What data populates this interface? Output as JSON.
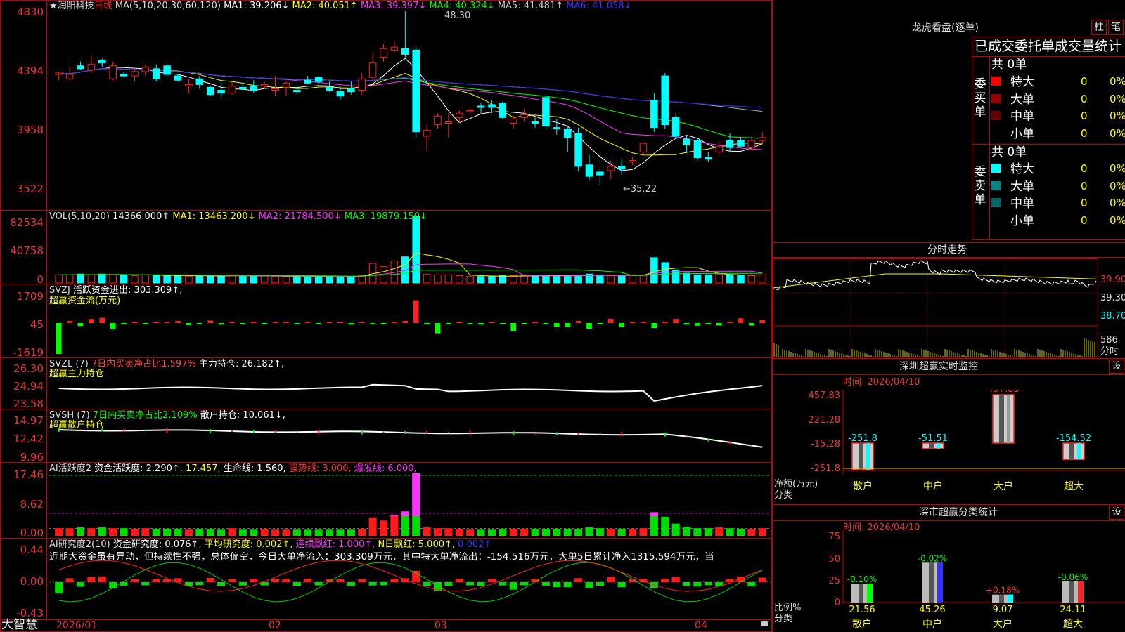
{
  "colors": {
    "up": "#ff2020",
    "down": "#00ffff",
    "ma1": "#ffffff",
    "ma2": "#ffff00",
    "ma3": "#ff33ff",
    "ma4": "#00ff00",
    "ma5": "#aaaaaa",
    "ma6": "#3333ff",
    "border": "#c00000"
  },
  "app": {
    "title": "★润阳科技",
    "period": "日线",
    "brand": "大智慧"
  },
  "price_legend": {
    "ma": "MA(5,10,20,30,60,120)",
    "ma1": "MA1: 39.206↓",
    "ma2": "MA2: 40.051↑",
    "ma3": "MA3: 39.397↓",
    "ma4": "MA4: 40.324↓",
    "ma5": "MA5: 41.481↑",
    "ma6": "MA6: 41.058↓",
    "high_mark": "48.30",
    "low_mark": "←35.22"
  },
  "vol_legend": {
    "name": "VOL(5,10,20)",
    "v": "14366.000↑",
    "ma1": "MA1: 13463.200↓",
    "ma2": "MA2: 21784.500↓",
    "ma3": "MA3: 19879.150↓"
  },
  "svzj": {
    "name": "SVZJ",
    "text": "活跃资金进出: 303.309↑,",
    "sub": "超赢资金流(万元)"
  },
  "svzl": {
    "name": "SVZL (7)",
    "pct": "7日内买卖净占比1.597%",
    "text": "主力持仓: 26.182↑,",
    "sub": "超赢主力持仓"
  },
  "svsh": {
    "name": "SVSH (7)",
    "pct": "7日内买卖净占比2.109%",
    "text": "散户持仓: 10.061↓,",
    "sub": "超赢散户持仓"
  },
  "ai1": {
    "name": "AI活跃度2",
    "a": "资金活跃度: 2.290↑,",
    "b": "17.457,",
    "c": "生命线: 1.560,",
    "d": "强势线: 3.000,",
    "e": "爆发线: 6.000,"
  },
  "ai2": {
    "name": "AI研究度2(10)",
    "a": "资金研究度: 0.076↑,",
    "b": "平均研究度: 0.002↑,",
    "c": "连续飘红: 1.000↑,",
    "d": "N日飘红: 5.000↑,",
    "e": "0.002↑",
    "comment": "近期大资金虽有异动，但持续性不强，总体偏空，今日大单净流入：303.309万元，其中特大单净流出：-154.516万元，大单5日累计净入1315.594万元，当"
  },
  "axes": {
    "price": [
      "4830",
      "4394",
      "3958",
      "3522"
    ],
    "vol": [
      "82534",
      "40758",
      "0"
    ],
    "svzj": [
      "1709",
      "45",
      "-1619"
    ],
    "svzl": [
      "26.30",
      "24.94",
      "23.58"
    ],
    "svsh": [
      "14.97",
      "12.42",
      "9.96"
    ],
    "ai1": [
      "17.46",
      "8.62",
      "0.00"
    ],
    "ai2": [
      "0.44",
      "0.00",
      "-0.43"
    ]
  },
  "dates": [
    "2026/01",
    "02",
    "03",
    "04"
  ],
  "lhb": {
    "title": "龙虎看盘(逐单)",
    "btn1": "柱",
    "btn2": "笔",
    "subtitle": "已成交委托单成交量统计",
    "buy_label": "委买单",
    "sell_label": "委卖单",
    "total_buy": "共 0单",
    "total_sell": "共 0单",
    "buy": [
      {
        "name": "特大",
        "qty": "0",
        "pct": "0%",
        "color": "#ff0000"
      },
      {
        "name": "大单",
        "qty": "0",
        "pct": "0%",
        "color": "#990000"
      },
      {
        "name": "中单",
        "qty": "0",
        "pct": "0%",
        "color": "#660000"
      },
      {
        "name": "小单",
        "qty": "0",
        "pct": "0%",
        "color": "#000000"
      }
    ],
    "sell": [
      {
        "name": "特大",
        "qty": "0",
        "pct": "0%",
        "color": "#00ffff"
      },
      {
        "name": "大单",
        "qty": "0",
        "pct": "0%",
        "color": "#008888"
      },
      {
        "name": "中单",
        "qty": "0",
        "pct": "0%",
        "color": "#006666"
      },
      {
        "name": "小单",
        "qty": "0",
        "pct": "0%",
        "color": "#000000"
      }
    ]
  },
  "fenshi": {
    "title": "分时走势",
    "p1": "39.90",
    "p2": "39.30",
    "p3": "38.70",
    "v": "586",
    "unit": "分时"
  },
  "monitor": {
    "title": "深圳超赢实时监控",
    "btn": "设",
    "time": "时间: 2026/04/10",
    "axis": [
      "457.83",
      "221.28",
      "-15.28",
      "-251.8"
    ],
    "ylabel1": "净额(万元)",
    "ylabel2": "分类",
    "cats": [
      "散户",
      "中户",
      "大户",
      "超大"
    ],
    "vals": [
      "-251.8",
      "-51.51",
      "457.83",
      "-154.52"
    ]
  },
  "classify": {
    "title": "深市超赢分类统计",
    "btn": "设",
    "time": "时间: 2026/04/10",
    "axis": [
      "75",
      "50",
      "25",
      "0"
    ],
    "ylabel1": "比例%",
    "ylabel2": "分类",
    "cats": [
      "散户",
      "中户",
      "大户",
      "超大"
    ],
    "vals": [
      "21.56",
      "45.26",
      "9.07",
      "24.11"
    ],
    "deltas": [
      "-0.10%",
      "-0.02%",
      "+0.18%",
      "-0.06%"
    ]
  },
  "chart_data": {
    "type": "candlestick",
    "title": "润阳科技 日线",
    "price_range": [
      35.22,
      48.3
    ],
    "ohlc": [
      [
        43.9,
        44.1,
        43.5,
        44.0
      ],
      [
        43.6,
        44.4,
        43.5,
        43.9
      ],
      [
        44.5,
        44.8,
        44.2,
        44.3
      ],
      [
        44.2,
        45.2,
        44.0,
        44.6
      ],
      [
        44.9,
        45.0,
        44.4,
        44.7
      ],
      [
        43.6,
        44.8,
        43.5,
        44.5
      ],
      [
        43.9,
        44.1,
        43.7,
        43.8
      ],
      [
        43.8,
        44.4,
        43.4,
        44.1
      ],
      [
        44.1,
        44.6,
        43.8,
        44.4
      ],
      [
        44.3,
        44.6,
        43.4,
        43.6
      ],
      [
        44.5,
        44.7,
        43.8,
        43.9
      ],
      [
        43.8,
        43.9,
        43.4,
        43.5
      ],
      [
        43.1,
        43.6,
        42.6,
        43.2
      ],
      [
        43.6,
        43.8,
        42.9,
        43.2
      ],
      [
        43.0,
        43.1,
        42.4,
        42.5
      ],
      [
        42.8,
        43.5,
        42.3,
        42.6
      ],
      [
        42.6,
        43.4,
        42.5,
        43.1
      ],
      [
        43.0,
        43.3,
        42.8,
        42.9
      ],
      [
        43.1,
        43.5,
        42.6,
        42.8
      ],
      [
        43.1,
        43.4,
        42.9,
        43.2
      ],
      [
        42.8,
        43.8,
        42.4,
        42.9
      ],
      [
        43.0,
        43.4,
        42.4,
        43.3
      ],
      [
        42.8,
        43.2,
        42.5,
        42.7
      ],
      [
        43.5,
        43.8,
        43.2,
        43.3
      ],
      [
        43.7,
        43.8,
        43.2,
        43.4
      ],
      [
        43.0,
        43.4,
        42.7,
        42.8
      ],
      [
        42.7,
        43.1,
        42.1,
        42.4
      ],
      [
        42.9,
        43.4,
        42.5,
        42.7
      ],
      [
        42.8,
        44.0,
        42.5,
        43.6
      ],
      [
        43.7,
        45.4,
        43.5,
        44.7
      ],
      [
        45.1,
        46.0,
        44.8,
        45.7
      ],
      [
        45.6,
        46.2,
        45.4,
        45.8
      ],
      [
        45.7,
        48.3,
        45.1,
        45.3
      ],
      [
        45.6,
        45.8,
        39.5,
        39.9
      ],
      [
        39.6,
        40.4,
        38.6,
        40.0
      ],
      [
        40.4,
        41.2,
        40.1,
        41.0
      ],
      [
        40.5,
        41.2,
        39.5,
        40.6
      ],
      [
        40.9,
        41.4,
        40.5,
        41.2
      ],
      [
        41.4,
        41.6,
        41.1,
        41.4
      ],
      [
        41.7,
        41.9,
        41.2,
        41.6
      ],
      [
        41.8,
        42.1,
        41.2,
        41.6
      ],
      [
        41.9,
        42.0,
        40.8,
        40.9
      ],
      [
        40.5,
        41.0,
        40.1,
        40.8
      ],
      [
        40.9,
        41.5,
        40.6,
        41.1
      ],
      [
        40.6,
        40.9,
        40.2,
        40.5
      ],
      [
        42.3,
        42.5,
        40.1,
        40.3
      ],
      [
        40.2,
        40.8,
        39.7,
        40.1
      ],
      [
        40.1,
        40.3,
        38.5,
        39.5
      ],
      [
        39.8,
        40.2,
        37.2,
        37.5
      ],
      [
        37.6,
        38.3,
        36.5,
        36.8
      ],
      [
        37.1,
        37.4,
        36.2,
        36.9
      ],
      [
        37.2,
        37.9,
        36.6,
        37.5
      ],
      [
        37.5,
        38.0,
        36.9,
        37.3
      ],
      [
        37.8,
        38.2,
        37.6,
        37.9
      ],
      [
        38.5,
        39.2,
        38.3,
        39.1
      ],
      [
        42.1,
        42.6,
        39.9,
        40.2
      ],
      [
        43.8,
        44.0,
        40.1,
        40.4
      ],
      [
        40.9,
        41.2,
        39.4,
        39.6
      ],
      [
        39.4,
        39.6,
        38.4,
        39.0
      ],
      [
        39.3,
        39.5,
        37.9,
        38.1
      ],
      [
        38.1,
        38.5,
        37.8,
        38.0
      ],
      [
        38.5,
        39.3,
        38.3,
        38.9
      ],
      [
        39.3,
        39.8,
        38.5,
        38.8
      ],
      [
        39.3,
        39.5,
        38.8,
        38.9
      ],
      [
        38.8,
        39.6,
        38.6,
        39.3
      ],
      [
        39.3,
        39.9,
        39.1,
        39.5
      ]
    ],
    "volume": [
      10,
      10,
      11,
      10,
      11,
      10,
      10,
      9,
      10,
      9,
      9,
      9,
      8,
      9,
      9,
      8,
      10,
      8,
      8,
      9,
      8,
      8,
      8,
      8,
      8,
      8,
      8,
      8,
      9,
      24,
      20,
      27,
      32,
      82,
      11,
      10,
      10,
      9,
      8,
      8,
      8,
      9,
      9,
      9,
      9,
      9,
      9,
      9,
      9,
      11,
      10,
      9,
      9,
      9,
      10,
      31,
      25,
      16,
      12,
      10,
      10,
      11,
      10,
      9,
      9,
      10
    ],
    "series": [
      {
        "name": "MA1",
        "label": "MA1: 39.206"
      },
      {
        "name": "MA2",
        "label": "MA2: 40.051"
      },
      {
        "name": "MA3",
        "label": "MA3: 39.397"
      },
      {
        "name": "MA4",
        "label": "MA4: 40.324"
      },
      {
        "name": "MA5",
        "label": "MA5: 41.481"
      },
      {
        "name": "MA6",
        "label": "MA6: 41.058"
      }
    ],
    "fund_flow": [
      -1500,
      100,
      -150,
      200,
      250,
      -300,
      -50,
      20,
      -30,
      50,
      0,
      100,
      -100,
      -20,
      120,
      -80,
      30,
      -50,
      60,
      -40,
      20,
      50,
      -60,
      70,
      -30,
      20,
      0,
      -80,
      30,
      -40,
      -20,
      60,
      100,
      1100,
      -70,
      -500,
      -60,
      60,
      -30,
      -80,
      40,
      -40,
      -400,
      -30,
      60,
      -50,
      -200,
      -200,
      100,
      -280,
      -60,
      210,
      -200,
      0,
      40,
      -240,
      50,
      200,
      -80,
      -130,
      -20,
      -120,
      40,
      230,
      -120,
      150,
      -120,
      40,
      -20,
      -30,
      -20,
      60
    ]
  }
}
